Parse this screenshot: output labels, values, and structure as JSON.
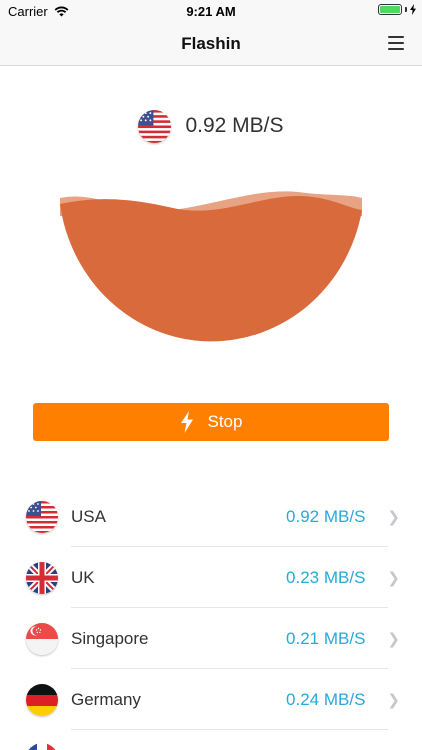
{
  "status_bar": {
    "carrier": "Carrier",
    "time": "9:21 AM"
  },
  "nav": {
    "title": "Flashin",
    "menu_icon": "hamburger-menu-icon"
  },
  "current": {
    "flag": "usa-flag-icon",
    "speed": "0.92 MB/S"
  },
  "gauge": {
    "fill_color": "#d96a3b",
    "wave_color": "#e9a384"
  },
  "stop_button": {
    "label": "Stop",
    "icon": "lightning-bolt-icon",
    "color": "#ff8000"
  },
  "servers": [
    {
      "name": "USA",
      "speed": "0.92 MB/S",
      "flag": "usa-flag-icon"
    },
    {
      "name": "UK",
      "speed": "0.23 MB/S",
      "flag": "uk-flag-icon"
    },
    {
      "name": "Singapore",
      "speed": "0.21 MB/S",
      "flag": "singapore-flag-icon"
    },
    {
      "name": "Germany",
      "speed": "0.24 MB/S",
      "flag": "germany-flag-icon"
    },
    {
      "name": "",
      "speed": "",
      "flag": "france-flag-icon"
    }
  ],
  "colors": {
    "speed_text": "#2aa8d8",
    "chevron": "#c7c7cc"
  }
}
